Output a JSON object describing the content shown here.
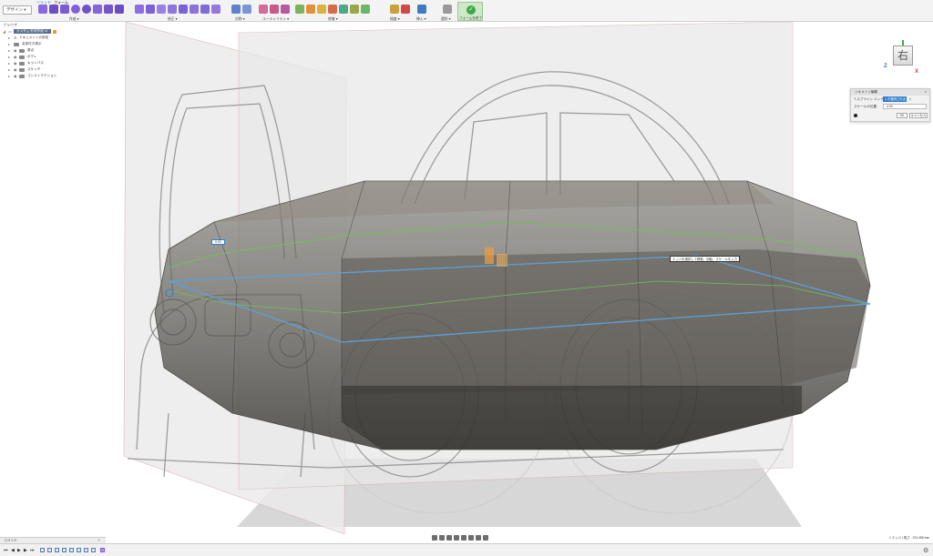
{
  "toolbar": {
    "mode_label": "デザイン ▾",
    "tabs": [
      "ソリッド",
      "フォーム"
    ],
    "groups": [
      {
        "label": "作成 ▾"
      },
      {
        "label": "修正 ▾"
      },
      {
        "label": "対称 ▾"
      },
      {
        "label": "ユーティリティ ▾"
      },
      {
        "label": "修復 ▾"
      },
      {
        "label": "検査 ▾"
      },
      {
        "label": "挿入 ▾"
      },
      {
        "label": "選択 ▾"
      }
    ],
    "finish_label": "フォームを終了"
  },
  "browser": {
    "title": "ブラウザ",
    "root_label": "カスタム 形状作成 v1",
    "items": [
      {
        "label": "ドキュメントの設定"
      },
      {
        "label": "名前付き表示"
      },
      {
        "label": "原点"
      },
      {
        "label": "ボディ"
      },
      {
        "label": "キャンバス"
      },
      {
        "label": "スケッチ"
      },
      {
        "label": "コンストラクション"
      }
    ]
  },
  "viewcube": {
    "face": "右",
    "axis_z": "Z",
    "axis_x": "X"
  },
  "dialog": {
    "title": "ジオメトリ編集",
    "row1_label": "T-スプライン エンティティ",
    "row1_value": "1 が選択されました",
    "row2_label": "スケールの位置",
    "row2_value": "-4.00",
    "ok_label": "OK",
    "cancel_label": "キャンセル"
  },
  "viewport": {
    "value_box": "0.00",
    "tooltip": "エッジを選択して移動、回転、スケールを入力",
    "center_marker": "中"
  },
  "bottom": {
    "comments_label": "コメント",
    "status_text": "1 エッジ | 長さ : 123.456 mm"
  },
  "timeline": {
    "controls": [
      "⏮",
      "◀",
      "▶",
      "▶",
      "⏭"
    ]
  },
  "colors": {
    "accent": "#2f7fd1",
    "finish_green": "#3aa84a"
  }
}
